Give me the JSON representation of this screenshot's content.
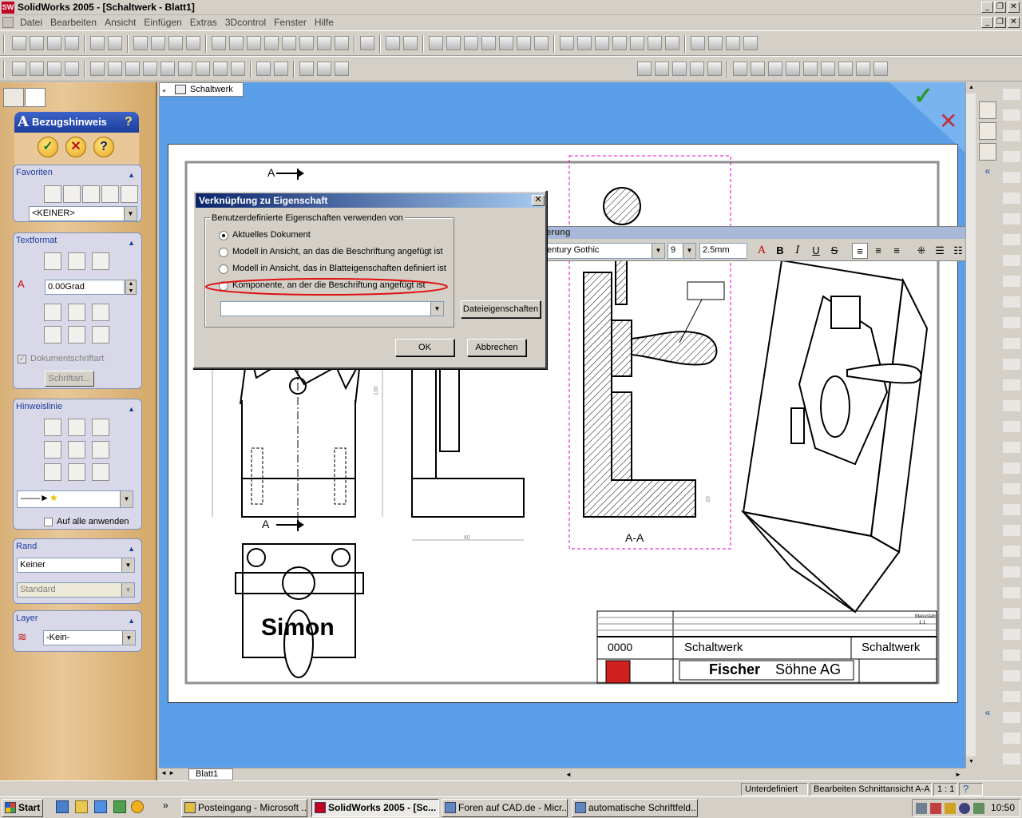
{
  "window": {
    "title": "SolidWorks 2005 - [Schaltwerk - Blatt1]",
    "icon_label": "SW"
  },
  "menu": [
    "Datei",
    "Bearbeiten",
    "Ansicht",
    "Einfügen",
    "Extras",
    "3Dcontrol",
    "Fenster",
    "Hilfe"
  ],
  "panel": {
    "title": "Bezugshinweis",
    "favoriten": {
      "label": "Favoriten",
      "select": "<KEINER>"
    },
    "textformat": {
      "label": "Textformat",
      "angle": "0.00Grad",
      "doc_font_label": "Dokumentschriftart",
      "font_button": "Schriftart..."
    },
    "hinweislinie": {
      "label": "Hinweislinie",
      "apply_all": "Auf alle anwenden"
    },
    "rand": {
      "label": "Rand",
      "style": "Keiner",
      "size": "Standard"
    },
    "layer": {
      "label": "Layer",
      "value": "-Kein-"
    }
  },
  "document": {
    "tab": "Schaltwerk",
    "sheet_tab": "Blatt1"
  },
  "drawing": {
    "section_label": "A-A",
    "section_mark": "A",
    "dim_60": "60",
    "dim_130": "130",
    "dim_20": "20",
    "nameplate": "Simon",
    "titleblock": {
      "number": "0000",
      "title1": "Schaltwerk",
      "title2": "Schaltwerk",
      "company_a": "Fischer",
      "company_b": "Söhne AG",
      "scale_label": "Massstab",
      "scale": "1:1"
    }
  },
  "dialog": {
    "title": "Verknüpfung zu Eigenschaft",
    "group": "Benutzerdefinierte Eigenschaften verwenden von",
    "options": [
      "Aktuelles Dokument",
      "Modell in Ansicht, an das die Beschriftung angefügt ist",
      "Modell in Ansicht, das in Blatteigenschaften definiert ist",
      "Komponente, an der die Beschriftung angefügt ist"
    ],
    "selected_index": 0,
    "file_props": "Dateieigenschaften",
    "ok": "OK",
    "cancel": "Abbrechen"
  },
  "format_bar": {
    "title": "erung",
    "font": "entury Gothic",
    "size": "9",
    "height": "2.5mm"
  },
  "status": {
    "left": "",
    "state": "Unterdefiniert",
    "action": "Bearbeiten Schnittansicht A-A",
    "scale": "1 : 1"
  },
  "taskbar": {
    "start": "Start",
    "tasks": [
      "Posteingang - Microsoft ...",
      "SolidWorks 2005 - [Sc...",
      "Foren auf CAD.de - Micr...",
      "automatische Schriftfeld..."
    ],
    "clock": "10:50",
    "chevron": "»"
  },
  "colors": {
    "title_grad_start": "#0a246a",
    "graphics_bg": "#5a9ee8",
    "panel_wood": "#e8c898",
    "highlight_ellipse": "#e01010",
    "selection_box": "#e000c0"
  }
}
